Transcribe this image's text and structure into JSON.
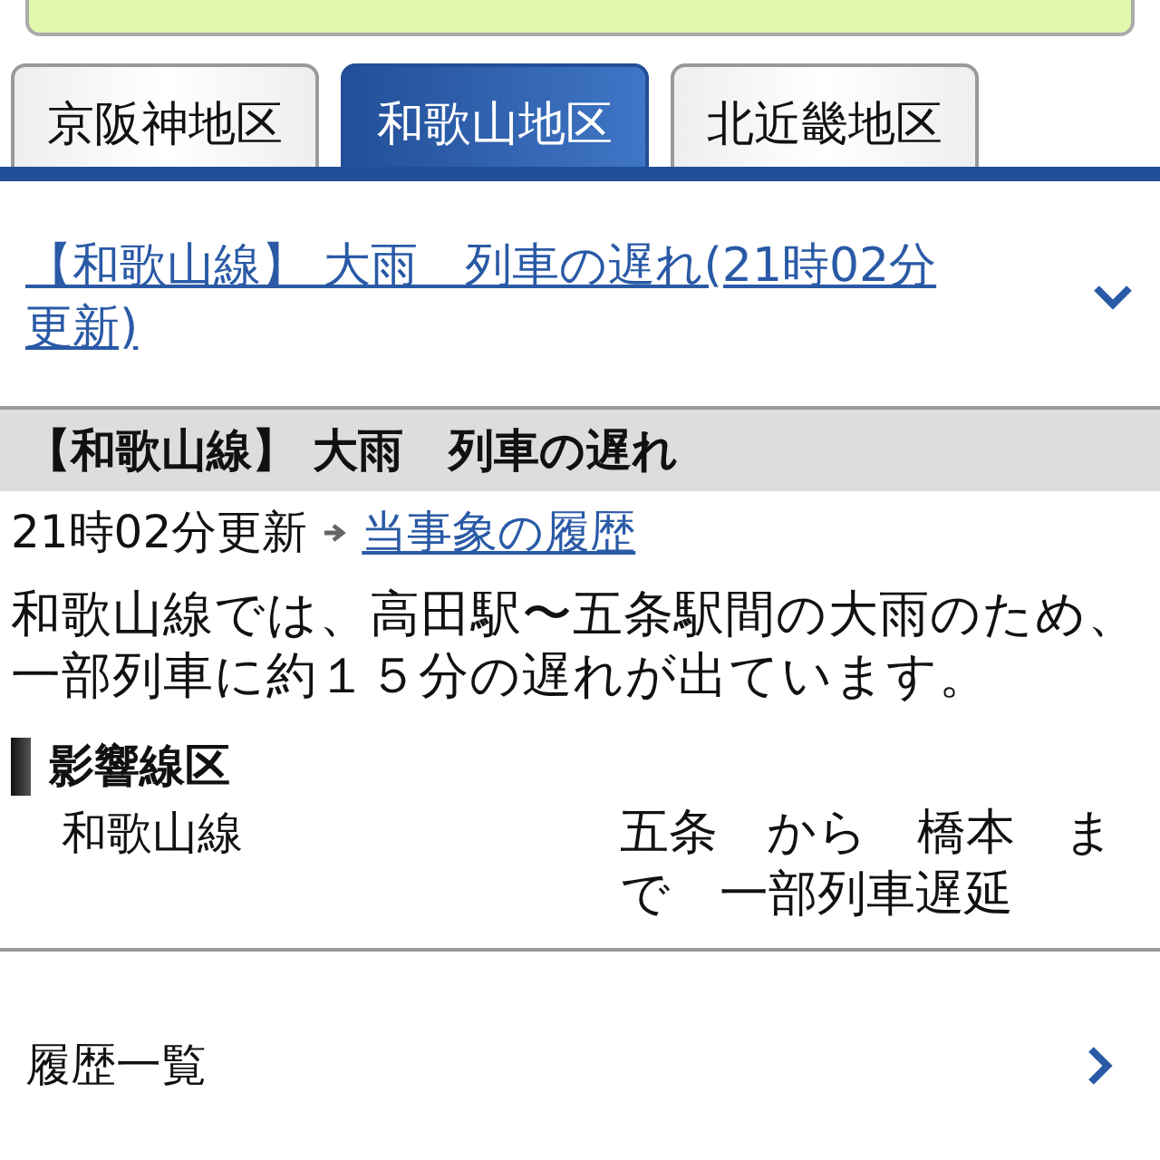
{
  "tabs": [
    {
      "label": "京阪神地区",
      "selected": false
    },
    {
      "label": "和歌山地区",
      "selected": true
    },
    {
      "label": "北近畿地区",
      "selected": false
    }
  ],
  "notice_link": {
    "text": "【和歌山線】 大雨　列車の遅れ(21時02分更新)",
    "expanded": true
  },
  "incident": {
    "title": "【和歌山線】 大雨　列車の遅れ",
    "updated": "21時02分更新",
    "history_link": "当事象の履歴",
    "message": "和歌山線では、高田駅〜五条駅間の大雨のため、一部列車に約１５分の遅れが出ています。",
    "affected_heading": "影響線区",
    "affected": [
      {
        "line": "和歌山線",
        "detail": "五条　から　橋本　まで　一部列車遅延"
      }
    ]
  },
  "history_list": {
    "label": "履歴一覧"
  }
}
